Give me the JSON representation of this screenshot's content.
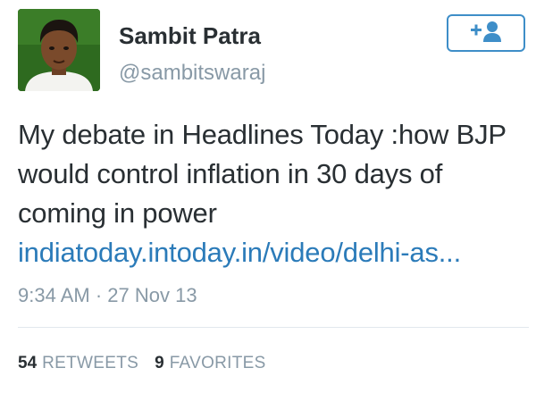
{
  "user": {
    "name": "Sambit Patra",
    "handle": "@sambitswaraj"
  },
  "follow_button": {
    "icon": "follow-plus-user-icon",
    "color": "#3e8ec8"
  },
  "tweet": {
    "text": "My debate in Headlines Today :how BJP would control inflation in 30 days of coming in power ",
    "link_text": "indiatoday.intoday.in/video/delhi-as...",
    "link_color": "#2b7bb9",
    "time": "9:34 AM",
    "separator": " · ",
    "date": "27 Nov 13"
  },
  "stats": {
    "retweets_count": "54",
    "retweets_label": "RETWEETS",
    "favorites_count": "9",
    "favorites_label": "FAVORITES"
  }
}
